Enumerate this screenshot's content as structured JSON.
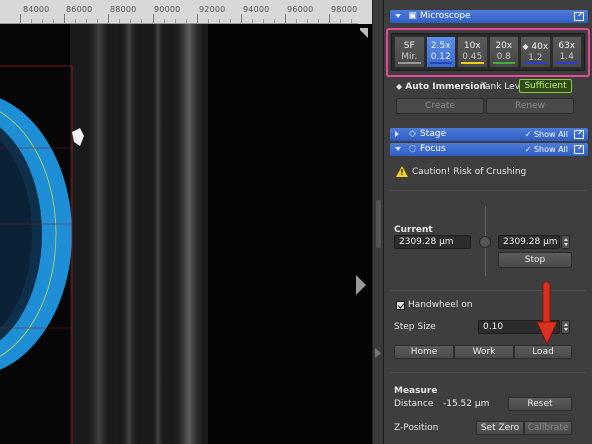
{
  "ruler": {
    "labels": [
      "84000",
      "86000",
      "88000",
      "90000",
      "92000",
      "94000",
      "96000",
      "98000"
    ]
  },
  "panels": {
    "microscope": {
      "title": "Microscope",
      "objectives": [
        {
          "mag": "SF",
          "na": "Mir.",
          "active": false,
          "bar_color": "#9a9a9a"
        },
        {
          "mag": "2.5x",
          "na": "0.12",
          "active": true,
          "bar_color": "#3a66d8"
        },
        {
          "mag": "10x",
          "na": "0.45",
          "active": false,
          "bar_color": "#e8d21a"
        },
        {
          "mag": "20x",
          "na": "0.8",
          "active": false,
          "bar_color": "#3fae3a"
        },
        {
          "mag": "40x",
          "na": "1.2",
          "active": false,
          "bar_color": "#2a3fd0",
          "prefix": "◆"
        },
        {
          "mag": "63x",
          "na": "1.4",
          "active": false,
          "bar_color": "#2a3fd0"
        }
      ],
      "auto_immersion_label": "Auto Immersion",
      "tank_level_label": "Tank Level",
      "tank_level_value": "Sufficient",
      "create_label": "Create",
      "renew_label": "Renew"
    },
    "stage": {
      "title": "Stage",
      "show_all": "Show All"
    },
    "focus": {
      "title": "Focus",
      "show_all": "Show All",
      "warning": "Caution! Risk of Crushing",
      "current_label": "Current",
      "current_value": "2309.28 µm",
      "target_value": "2309.28 µm",
      "stop_label": "Stop",
      "handwheel_label": "Handwheel on",
      "handwheel_on": true,
      "step_size_label": "Step Size",
      "step_size_value": "0.10",
      "home_label": "Home",
      "work_label": "Work",
      "load_label": "Load",
      "measure_label": "Measure",
      "distance_label": "Distance",
      "distance_value": "-15.52 µm",
      "reset_label": "Reset",
      "zposition_label": "Z-Position",
      "set_zero_label": "Set Zero",
      "calibrate_label": "Calibrate"
    }
  },
  "colors": {
    "header_blue": "#3a66d0",
    "highlight_magenta": "#e64a9a",
    "tank_ok_green": "#8acb3a",
    "specimen_blue": "#1e8fd6",
    "annotation_red": "#d9301f"
  }
}
